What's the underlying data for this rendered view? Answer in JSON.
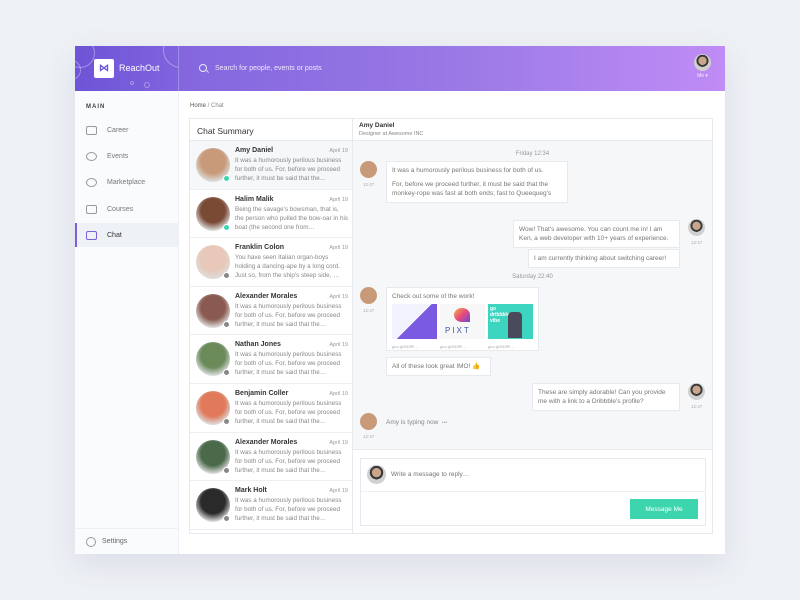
{
  "app": {
    "brand": "ReachOut",
    "logo_glyph": "⋈"
  },
  "search": {
    "placeholder": "Search for people, events or posts",
    "icon": "search-icon"
  },
  "user_menu": {
    "label": "Me ▾"
  },
  "sidebar": {
    "section": "MAIN",
    "items": [
      {
        "label": "Career",
        "icon": "briefcase-icon",
        "active": false
      },
      {
        "label": "Events",
        "icon": "users-icon",
        "active": false
      },
      {
        "label": "Marketplace",
        "icon": "palette-icon",
        "active": false
      },
      {
        "label": "Courses",
        "icon": "book-icon",
        "active": false
      },
      {
        "label": "Chat",
        "icon": "chat-icon",
        "active": true
      }
    ],
    "settings": "Settings"
  },
  "breadcrumb": {
    "home": "Home",
    "separator": " / ",
    "current": "Chat"
  },
  "chat_list": {
    "title": "Chat Summary",
    "items": [
      {
        "name": "Amy Daniel",
        "date": "April 19",
        "snippet": "It was a humorously perilous business for both of us. For, before we proceed further, it must be said that the…",
        "status": "online",
        "status_color": "#3dd5ae",
        "avatar_color": "#c89a7a"
      },
      {
        "name": "Halim Malik",
        "date": "April 19",
        "snippet": "Being the savage's bowsman, that is, the person who pulled the bow-oar in his boat (the second one from…",
        "status": "online",
        "status_color": "#3dd5ae",
        "avatar_color": "#7a4a35"
      },
      {
        "name": "Franklin Colon",
        "date": "April 19",
        "snippet": "You have seen Italian organ-boys holding a dancing-ape by a long cord. Just so, from the ship's steep side, …",
        "status": "offline",
        "status_color": "#888888",
        "avatar_color": "#e8c8b8"
      },
      {
        "name": "Alexander Morales",
        "date": "April 19",
        "snippet": "It was a humorously perilous business for both of us. For, before we proceed further, it must be said that the…",
        "status": "offline",
        "status_color": "#888888",
        "avatar_color": "#8a5a50"
      },
      {
        "name": "Nathan Jones",
        "date": "April 19",
        "snippet": "It was a humorously perilous business for both of us. For, before we proceed further, it must be said that the…",
        "status": "offline",
        "status_color": "#888888",
        "avatar_color": "#6a8a5a"
      },
      {
        "name": "Benjamin Coller",
        "date": "April 19",
        "snippet": "It was a humorously perilous business for both of us. For, before we proceed further, it must be said that the…",
        "status": "offline",
        "status_color": "#888888",
        "avatar_color": "#e07a5a"
      },
      {
        "name": "Alexander Morales",
        "date": "April 19",
        "snippet": "It was a humorously perilous business for both of us. For, before we proceed further, it must be said that the…",
        "status": "offline",
        "status_color": "#888888",
        "avatar_color": "#4a6a4a"
      },
      {
        "name": "Mark Holt",
        "date": "April 19",
        "snippet": "It was a humorously perilous business for both of us. For, before we proceed further, it must be said that the…",
        "status": "offline",
        "status_color": "#888888",
        "avatar_color": "#2a2a2a"
      }
    ]
  },
  "conversation": {
    "name": "Amy Daniel",
    "role": "Designer at Awesome INC",
    "stamps": [
      "Friday 12:34",
      "Saturday 22:40"
    ],
    "messages": [
      {
        "from": "Amy",
        "time": "12:47",
        "lines": [
          "It was a humorously perilous business for both of us.",
          "For, before we proceed further, it must be said that the monkey-rope was fast at both ends; fast to Queequeg's"
        ]
      },
      {
        "from": "Me",
        "time": "12:47",
        "text": "Wow! That's awesome. You can count me in! I am Ken, a web developer with 10+ years of experience."
      },
      {
        "from": "Me",
        "text": "I am currently thinking about switching career!"
      },
      {
        "from": "Amy",
        "time": "12:47",
        "text": "Check out some of the work!",
        "attachments": [
          {
            "caption": "goo.gl/345Pl…",
            "colors": [
              "#eef0ff",
              "#6b4ad8"
            ]
          },
          {
            "caption": "goo.gl/345Pl…",
            "colors": [
              "#f5f5f5",
              "#e94a7a"
            ],
            "label": "PIXT"
          },
          {
            "caption": "goo.gl/345Pl…",
            "colors": [
              "#3dd5c0",
              "#3a3a4a"
            ],
            "label": "go dribbble vibe"
          }
        ]
      },
      {
        "from": "Amy",
        "text": "All of these look great IMO! 👍"
      },
      {
        "from": "Me",
        "time": "12:47",
        "text": "These are simply adorable! Can you provide me with a link to a Dribbble's profile?"
      }
    ],
    "typing": {
      "text": "Amy is typing now",
      "dots": "•••",
      "time": "12:47"
    }
  },
  "composer": {
    "placeholder": "Write a message to reply…",
    "send_label": "Message Me",
    "send_color": "#3dd5ae"
  }
}
